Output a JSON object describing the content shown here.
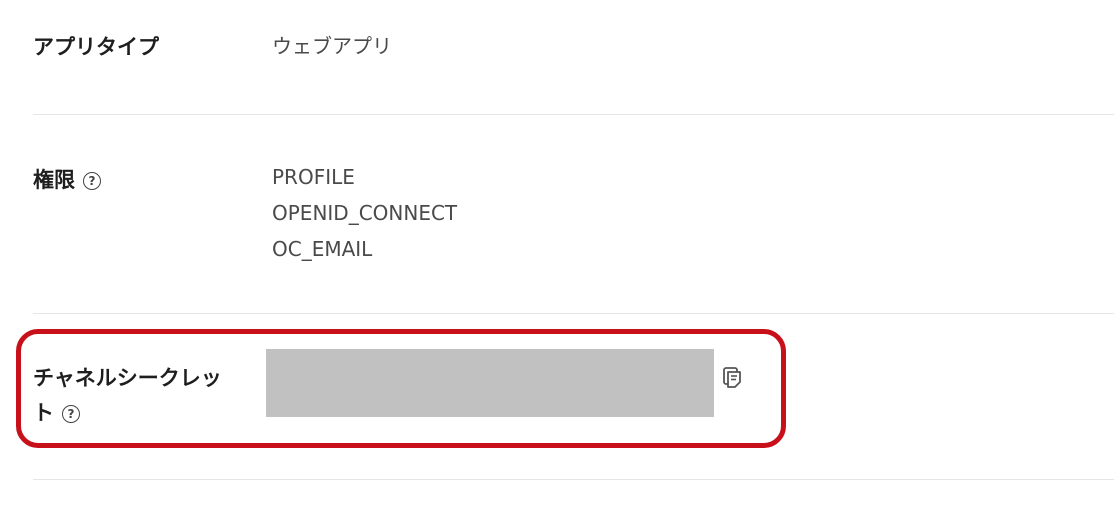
{
  "rows": [
    {
      "label": "アプリタイプ",
      "value": "ウェブアプリ"
    },
    {
      "label": "権限",
      "help_symbol": "?",
      "values": [
        "PROFILE",
        "OPENID_CONNECT",
        "OC_EMAIL"
      ]
    },
    {
      "label_line1": "チャネルシークレッ",
      "label_line2": "ト",
      "help_symbol": "?",
      "value_masked": true,
      "copy_icon": "copy-icon"
    }
  ],
  "colors": {
    "highlight": "#c8101a",
    "mask": "#c1c1c1",
    "divider": "#e6e6e6"
  }
}
